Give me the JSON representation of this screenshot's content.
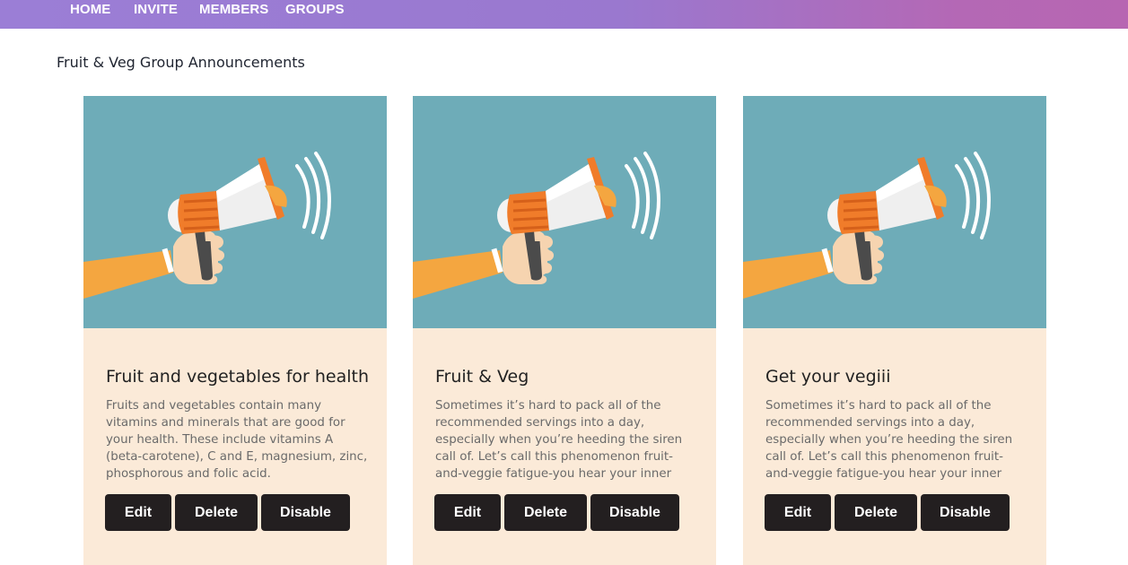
{
  "nav": {
    "items": [
      {
        "label": "HOME"
      },
      {
        "label": "INVITE"
      },
      {
        "label": "MEMBERS"
      },
      {
        "label": "GROUPS"
      }
    ]
  },
  "page": {
    "title": "Fruit & Veg Group Announcements"
  },
  "colors": {
    "nav_gradient_start": "#9b7ed6",
    "nav_gradient_end": "#b766b2",
    "card_image_bg": "#6eacb8",
    "card_bg": "#fbead8",
    "button_bg": "#231f20"
  },
  "cards": [
    {
      "image_icon": "megaphone-icon",
      "title": "Fruit and vegetables for health",
      "body": "Fruits and vegetables contain many vitamins and minerals that are good for your health. These include vitamins A (beta-carotene), C and E, magnesium, zinc, phosphorous and folic acid.",
      "buttons": {
        "edit": "Edit",
        "delete": "Delete",
        "disable": "Disable"
      }
    },
    {
      "image_icon": "megaphone-icon",
      "title": "Fruit & Veg",
      "body": "Sometimes it’s hard to pack all of the recommended servings into a day, especially when you’re heeding the siren call of. Let’s call this phenomenon fruit-and-veggie fatigue-you hear your inner scold ...",
      "buttons": {
        "edit": "Edit",
        "delete": "Delete",
        "disable": "Disable"
      }
    },
    {
      "image_icon": "megaphone-icon",
      "title": "Get your vegiii",
      "body": "Sometimes it’s hard to pack all of the recommended servings into a day, especially when you’re heeding the siren call of. Let’s call this phenomenon fruit-and-veggie fatigue-you hear your inner scold ...",
      "buttons": {
        "edit": "Edit",
        "delete": "Delete",
        "disable": "Disable"
      }
    }
  ]
}
